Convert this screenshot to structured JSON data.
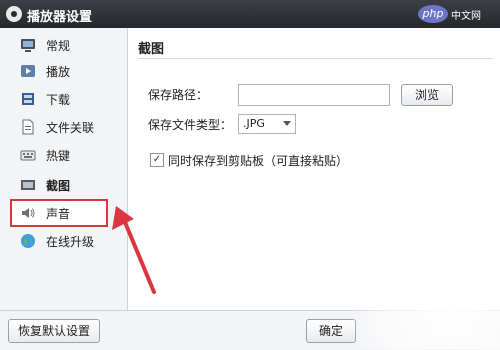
{
  "window": {
    "title": "播放器设置",
    "watermark_logo": "php",
    "watermark_site": "中文网"
  },
  "sidebar": {
    "items": [
      {
        "label": "常规",
        "icon": "monitor-icon"
      },
      {
        "label": "播放",
        "icon": "play-icon"
      },
      {
        "label": "下载",
        "icon": "download-icon"
      },
      {
        "label": "文件关联",
        "icon": "file-icon"
      },
      {
        "label": "热键",
        "icon": "keyboard-icon"
      },
      {
        "label": "截图",
        "icon": "screenshot-icon"
      },
      {
        "label": "声音",
        "icon": "speaker-icon"
      },
      {
        "label": "在线升级",
        "icon": "globe-icon"
      }
    ],
    "active_index": 5
  },
  "content": {
    "section_title": "截图",
    "save_path_label": "保存路径：",
    "save_path_value": "",
    "browse_label": "浏览",
    "file_type_label": "保存文件类型：",
    "file_type_value": ".JPG",
    "clipboard_checked": true,
    "clipboard_label": "同时保存到剪贴板（可直接粘贴）"
  },
  "footer": {
    "restore_label": "恢复默认设置",
    "ok_label": "确定"
  },
  "colors": {
    "annotation_red": "#d9363e",
    "titlebar": "#2d3035"
  }
}
